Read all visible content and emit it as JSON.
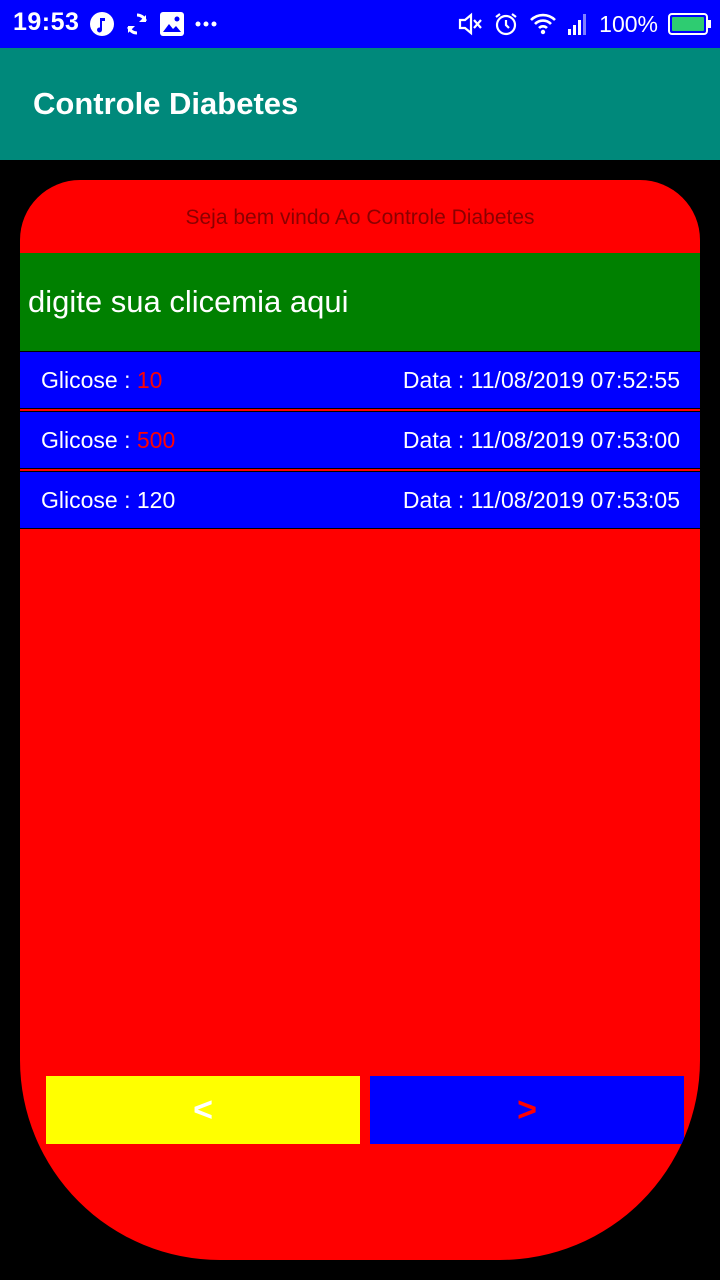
{
  "status_bar": {
    "time": "19:53",
    "battery": "100%",
    "left_icons": [
      "music-note-icon",
      "sync-icon",
      "image-icon",
      "more-dots-icon"
    ],
    "right_icons": [
      "mute-icon",
      "alarm-icon",
      "wifi-icon",
      "signal-icon",
      "battery-icon"
    ]
  },
  "app_bar": {
    "title": "Controle Diabetes",
    "color": "#00897b"
  },
  "welcome": "Seja bem vindo Ao Controle Diabetes",
  "glucose_input": {
    "placeholder": "digite sua clicemia aqui"
  },
  "records": [
    {
      "label": "Glicose : ",
      "value": "10",
      "alert": true,
      "date": "Data : 11/08/2019 07:52:55"
    },
    {
      "label": "Glicose : ",
      "value": "500",
      "alert": true,
      "date": "Data : 11/08/2019 07:53:00"
    },
    {
      "label": "Glicose : ",
      "value": "120",
      "alert": false,
      "date": "Data : 11/08/2019 07:53:05"
    }
  ],
  "nav": {
    "prev_label": "<",
    "next_label": ">"
  },
  "colors": {
    "status_bar": "#0000ff",
    "panel": "#ff0000",
    "input": "#008000",
    "row": "#0000ff",
    "prev_button": "#ffff00",
    "next_button": "#0000ff",
    "alert_value": "#ff0000"
  }
}
